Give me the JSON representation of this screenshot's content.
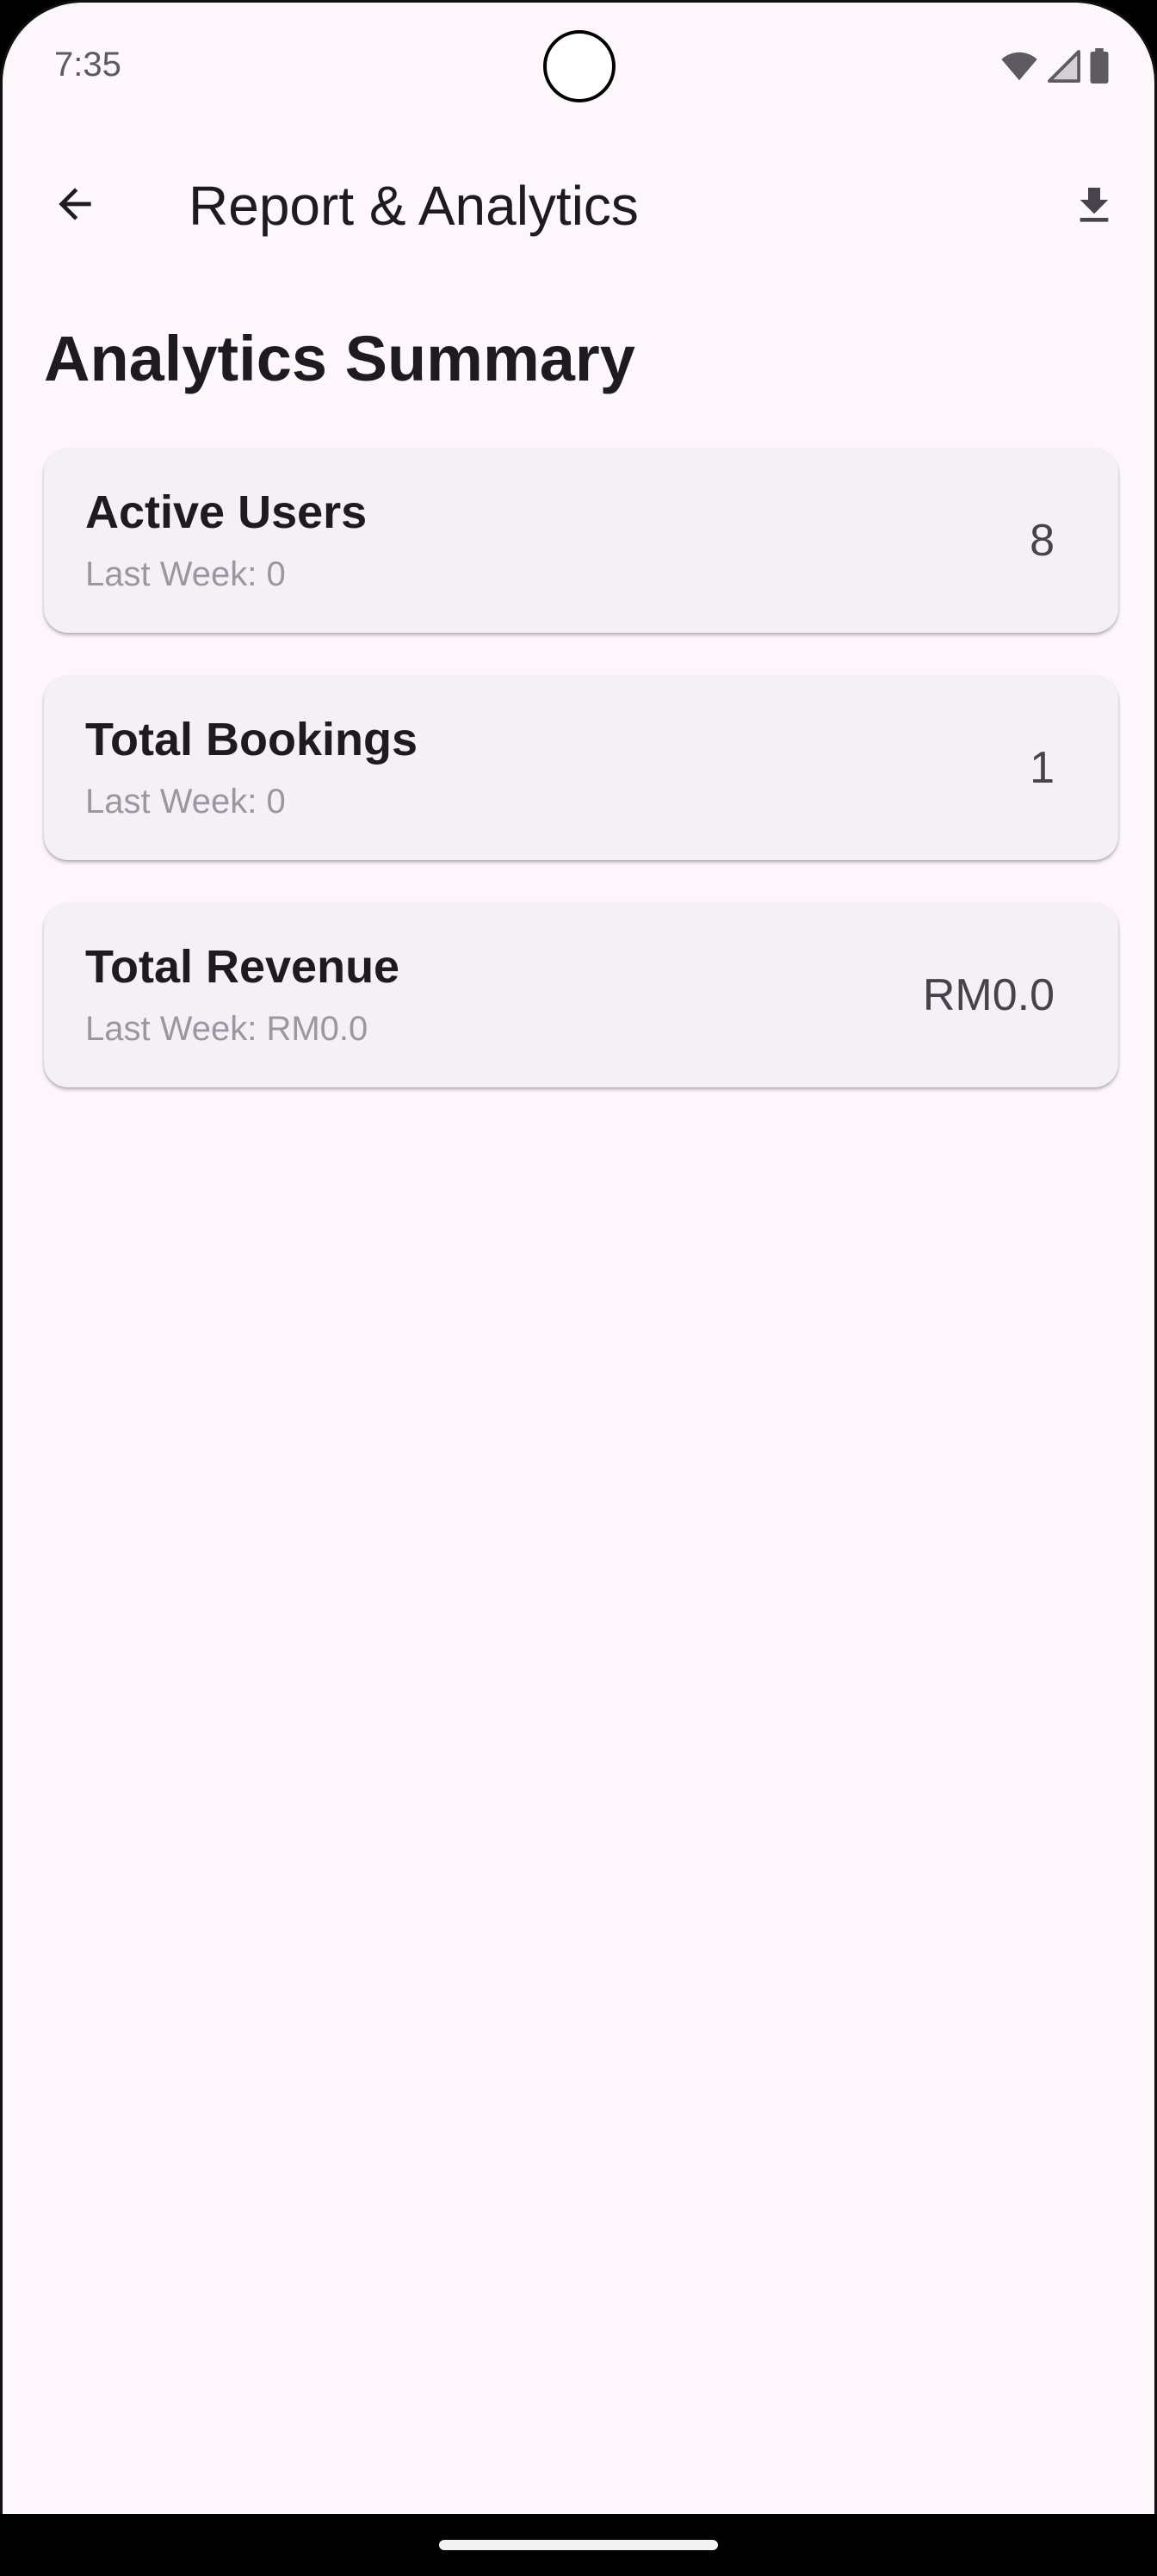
{
  "status_bar": {
    "time": "7:35"
  },
  "app_bar": {
    "title": "Report & Analytics",
    "back_icon": "arrow-back-icon",
    "download_icon": "download-icon"
  },
  "summary": {
    "heading": "Analytics Summary",
    "cards": [
      {
        "label": "Active Users",
        "last_week": "Last Week: 0",
        "value": "8"
      },
      {
        "label": "Total Bookings",
        "last_week": "Last Week: 0",
        "value": "1"
      },
      {
        "label": "Total Revenue",
        "last_week": "Last Week: RM0.0",
        "value": "RM0.0"
      }
    ]
  },
  "colors": {
    "background": "#fdf7fc",
    "card": "#f4f0f6",
    "text_primary": "#1d1b20",
    "text_secondary": "#9b979e"
  }
}
